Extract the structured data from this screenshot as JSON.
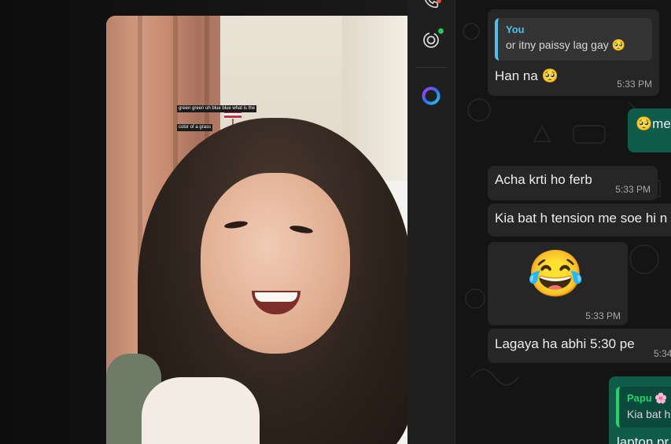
{
  "video": {
    "caption_line1": "green green uh blue blue what is the",
    "caption_line2": "color of a grass",
    "board_scribble": "10-2-8"
  },
  "rail": {
    "items": [
      {
        "name": "calls-icon"
      },
      {
        "name": "status-icon",
        "has_update": true
      },
      {
        "name": "meta-ai-icon"
      }
    ]
  },
  "chat": {
    "messages": [
      {
        "id": "m1",
        "direction": "in",
        "quote_name": "You",
        "quote_text": "or itny paissy lag gay 🥺",
        "text": "Han na 🥺",
        "time": "5:33 PM"
      },
      {
        "id": "m2",
        "direction": "out",
        "text": "🥺me"
      },
      {
        "id": "m3",
        "direction": "in",
        "text": "Acha krti ho ferb",
        "time": "5:33 PM"
      },
      {
        "id": "m4",
        "direction": "in",
        "text": "Kia bat h tension me soe hi n"
      },
      {
        "id": "m5",
        "direction": "in",
        "emoji": "😂",
        "time": "5:33 PM"
      },
      {
        "id": "m6",
        "direction": "in",
        "text": "Lagaya ha abhi 5:30 pe",
        "time": "5:34"
      },
      {
        "id": "m7",
        "direction": "out",
        "quote_name": "Papu 🌸",
        "quote_text": "Kia bat h",
        "text": "lapton pr"
      }
    ]
  },
  "colors": {
    "incoming_bubble": "#262626",
    "outgoing_bubble": "#0f5c4a",
    "quote_accent_you": "#53bdeb",
    "quote_accent_contact": "#25d366"
  }
}
